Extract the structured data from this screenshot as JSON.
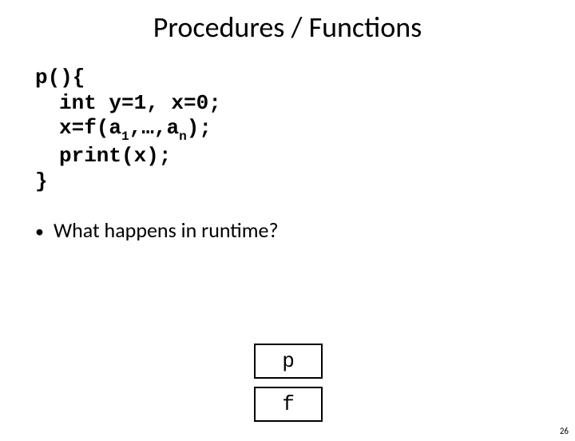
{
  "title": "Procedures / Functions",
  "code": {
    "l0": "p(){",
    "l1_pre": "int y=1, x=0;",
    "l2_pre": "x=f(a",
    "l2_sub1": "1",
    "l2_mid": ",…,a",
    "l2_sub2": "n",
    "l2_post": ");",
    "l3_pre": "print(x);",
    "l4": "}"
  },
  "bullet": "What happens in runtime?",
  "stack": {
    "top": "p",
    "bottom": "f"
  },
  "pagenum": "26"
}
